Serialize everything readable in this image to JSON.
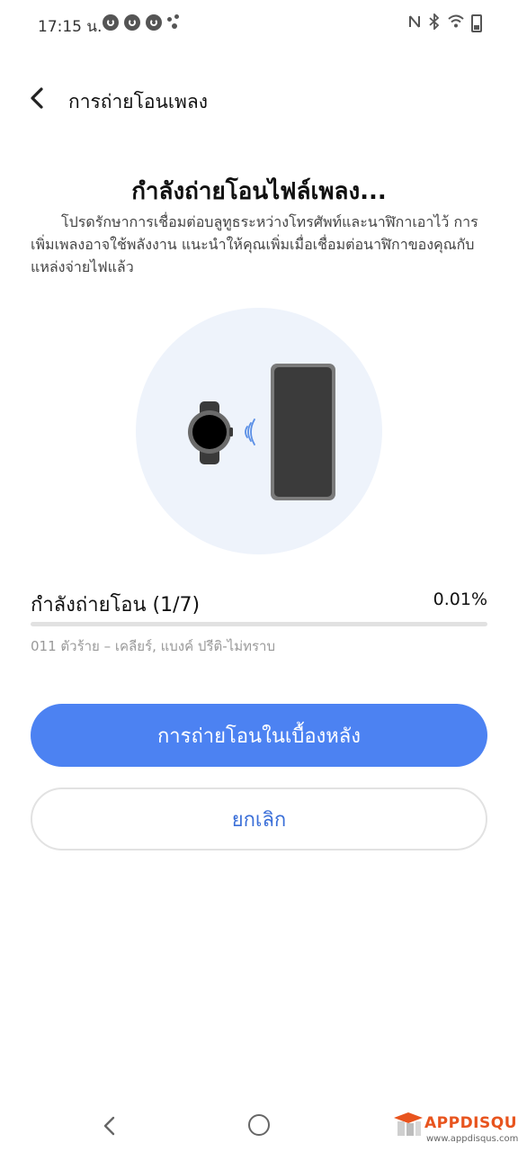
{
  "status_bar": {
    "time": "17:15 น."
  },
  "header": {
    "title": "การถ่ายโอนเพลง"
  },
  "main": {
    "title": "กำลังถ่ายโอนไฟล์เพลง...",
    "description": "โปรดรักษาการเชื่อมต่อบลูทูธระหว่างโทรศัพท์และนาฬิกาเอาไว้ การเพิ่มเพลงอาจใช้พลังงาน แนะนำให้คุณเพิ่มเมื่อเชื่อมต่อนาฬิกาของคุณกับแหล่งจ่ายไฟแล้ว"
  },
  "progress": {
    "label": "กำลังถ่ายโอน (1/7)",
    "percent_text": "0.01%",
    "value_percent": 0.01,
    "song": "011 ตัวร้าย – เคลียร์, แบงค์ ปรีติ-ไม่ทราบ"
  },
  "buttons": {
    "background_label": "การถ่ายโอนในเบื้องหลัง",
    "cancel_label": "ยกเลิก"
  },
  "icons": {
    "back": "chevron-left-icon",
    "watch": "smartwatch-icon",
    "bluetooth_waves": "signal-waves-icon",
    "phone": "smartphone-icon",
    "nav_back": "nav-back-icon",
    "nav_home": "nav-home-icon"
  },
  "colors": {
    "primary": "#4c82f2",
    "cancel_text": "#3b6fd8",
    "illustration_bg": "#eef3fb",
    "progress_fill": "#3d7bd6"
  },
  "watermark": {
    "brand": "APPDISQUS",
    "url": "www.appdisqus.com"
  }
}
